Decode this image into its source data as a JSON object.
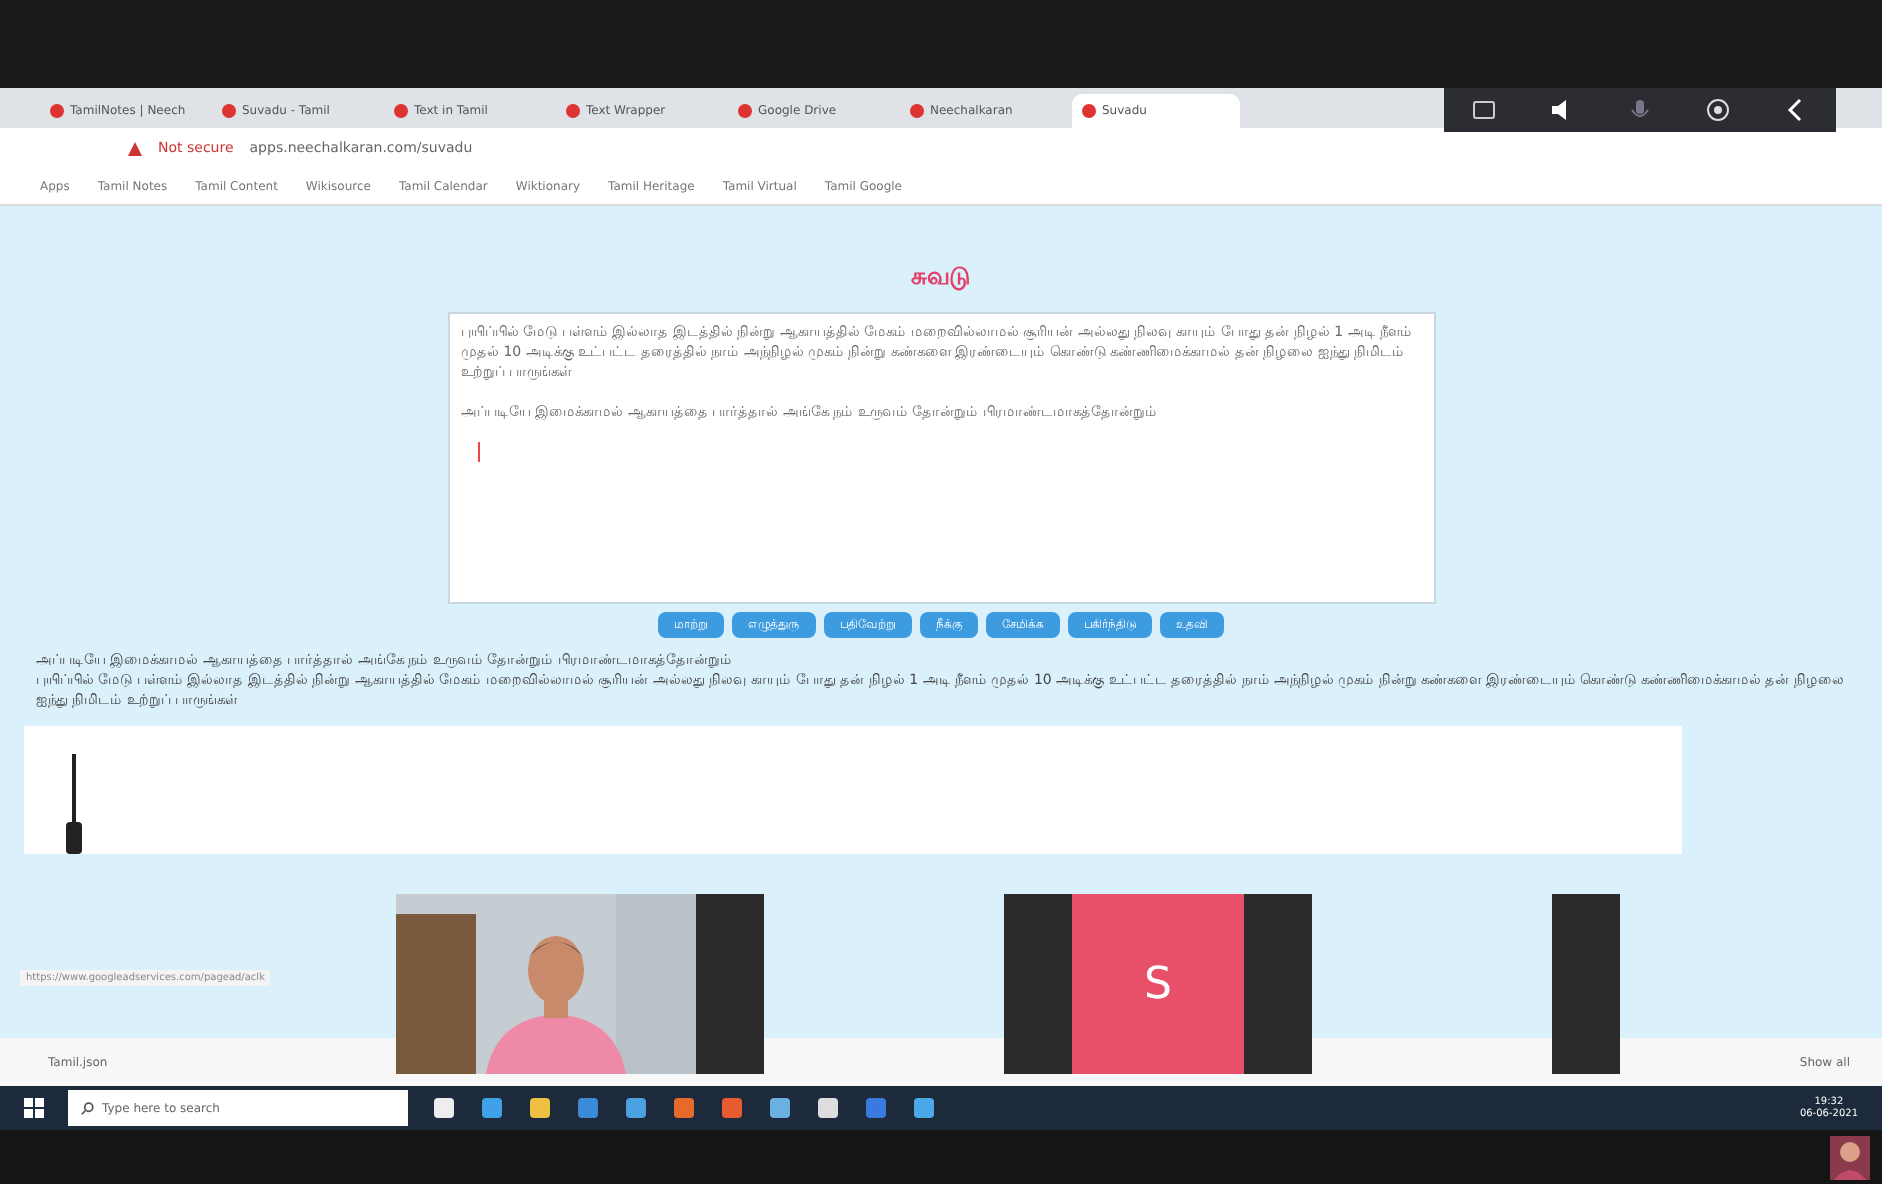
{
  "browser": {
    "tabs": [
      {
        "label": "TamilNotes | Neech",
        "selected": false
      },
      {
        "label": "Suvadu - Tamil",
        "selected": false
      },
      {
        "label": "Text in Tamil",
        "selected": false
      },
      {
        "label": "Text Wrapper",
        "selected": false
      },
      {
        "label": "Google Drive",
        "selected": false
      },
      {
        "label": "Neechalkaran",
        "selected": false
      },
      {
        "label": "Suvadu",
        "selected": true
      }
    ],
    "address": {
      "security": "Not secure",
      "url": "apps.neechalkaran.com/suvadu"
    },
    "bookmarks": [
      "Apps",
      "Tamil Notes",
      "Tamil Content",
      "Wikisource",
      "Tamil Calendar",
      "Wiktionary",
      "Tamil Heritage",
      "Tamil Virtual",
      "Tamil Google"
    ]
  },
  "page": {
    "title": "சுவடு",
    "editor": {
      "paragraphs": [
        "புயிப்பில் மேடு பள்ளம் இல்லாத இடத்தில் நின்று ஆகாயத்தில் மேகம் மறைவில்லாமல் சூரியன் அல்லது நிலவு காயும் போது தன் நிழல் 1 அடி நீளம் முதல் 10 அடிக்கு உட்பட்ட தரைத்தில் நாம் அந்நிழல் முகம் நின்று கண்களை இரண்டையும் கொண்டு கண்ணிமைக்காமல் தன் நிழலை ஐந்து நிமிடம் உற்றுப் பாருங்கள்",
        "அப்படியே இமைக்காமல் ஆகாயத்தை பார்த்தால் அங்கே நம் உருவம் தோன்றும் பிரமாண்டமாகத்தோன்றும்"
      ]
    },
    "buttons": [
      "மாற்று",
      "எழுத்துரு",
      "பதிவேற்று",
      "நீக்கு",
      "சேமிக்க",
      "பகிர்ந்திடு",
      "உதவி"
    ],
    "output": [
      "அப்படியே இமைக்காமல் ஆகாயத்தை பார்த்தால் அங்கே நம் உருவம் தோன்றும் பிரமாண்டமாகத்தோன்றும்",
      "புயிப்பில் மேடு பள்ளம் இல்லாத இடத்தில் நின்று ஆகாயத்தில் மேகம் மறைவில்லாமல் சூரியன் அல்லது நிலவு காயும் போது தன் நிழல் 1 அடி நீளம் முதல் 10 அடிக்கு உட்பட்ட தரைத்தில் நாம் அந்நிழல் முகம் நின்று கண்களை இரண்டையும் கொண்டு கண்ணிமைக்காமல் தன் நிழலை ஐந்து நிமிடம் உற்றுப் பாருங்கள்"
    ],
    "status_url": "https://www.googleadservices.com/pagead/aclk"
  },
  "video_tiles": [
    {
      "kind": "camera"
    },
    {
      "kind": "dark"
    },
    {
      "kind": "empty"
    },
    {
      "kind": "dark"
    },
    {
      "kind": "avatar",
      "initial": "S",
      "color": "#e8506a"
    },
    {
      "kind": "dark"
    },
    {
      "kind": "empty"
    },
    {
      "kind": "dark"
    }
  ],
  "downloads": {
    "file": "Tamil.json",
    "show_all": "Show all"
  },
  "taskbar": {
    "search_placeholder": "Type here to search",
    "time": "19:32",
    "date": "06-06-2021"
  }
}
